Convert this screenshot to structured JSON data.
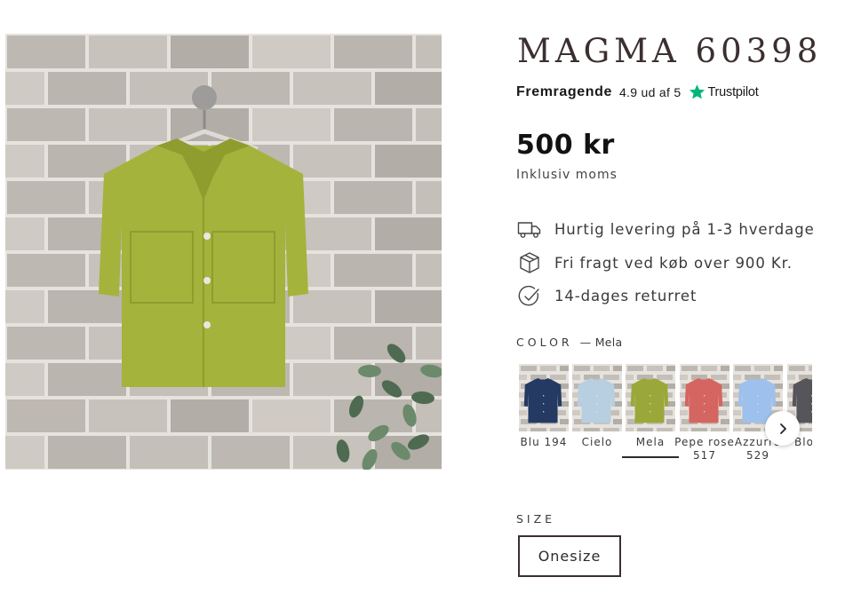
{
  "product": {
    "title": "MAGMA 60398",
    "image_alt": "Lime green short-sleeve shirt hanging on a grey brick wall",
    "price": "500 kr",
    "vat_note": "Inklusiv moms"
  },
  "rating": {
    "label": "Fremragende",
    "score_text": "4.9 ud af 5",
    "provider": "Trustpilot",
    "star_color": "#00b67a",
    "star_icon": "star-icon"
  },
  "features": [
    {
      "icon": "truck-icon",
      "text": "Hurtig levering på 1-3 hverdage"
    },
    {
      "icon": "box-icon",
      "text": "Fri fragt ved køb over 900 Kr."
    },
    {
      "icon": "check-circle-icon",
      "text": "14-dages returret"
    }
  ],
  "color": {
    "label": "COLOR",
    "selected": "— Mela",
    "swatches": [
      {
        "name": "Blu 194",
        "shirt_color": "#243a63"
      },
      {
        "name": "Cielo",
        "shirt_color": "#b7cfe0"
      },
      {
        "name": "Mela",
        "shirt_color": "#9aa83a",
        "selected": true
      },
      {
        "name": "Pepe rose 517",
        "shirt_color": "#d56560"
      },
      {
        "name": "Azzurro 529",
        "shirt_color": "#9ec0ec"
      },
      {
        "name": "Blo",
        "shirt_color": "#55555a"
      }
    ],
    "next_icon": "chevron-right-icon"
  },
  "size": {
    "label": "SIZE",
    "options": [
      "Onesize"
    ]
  }
}
